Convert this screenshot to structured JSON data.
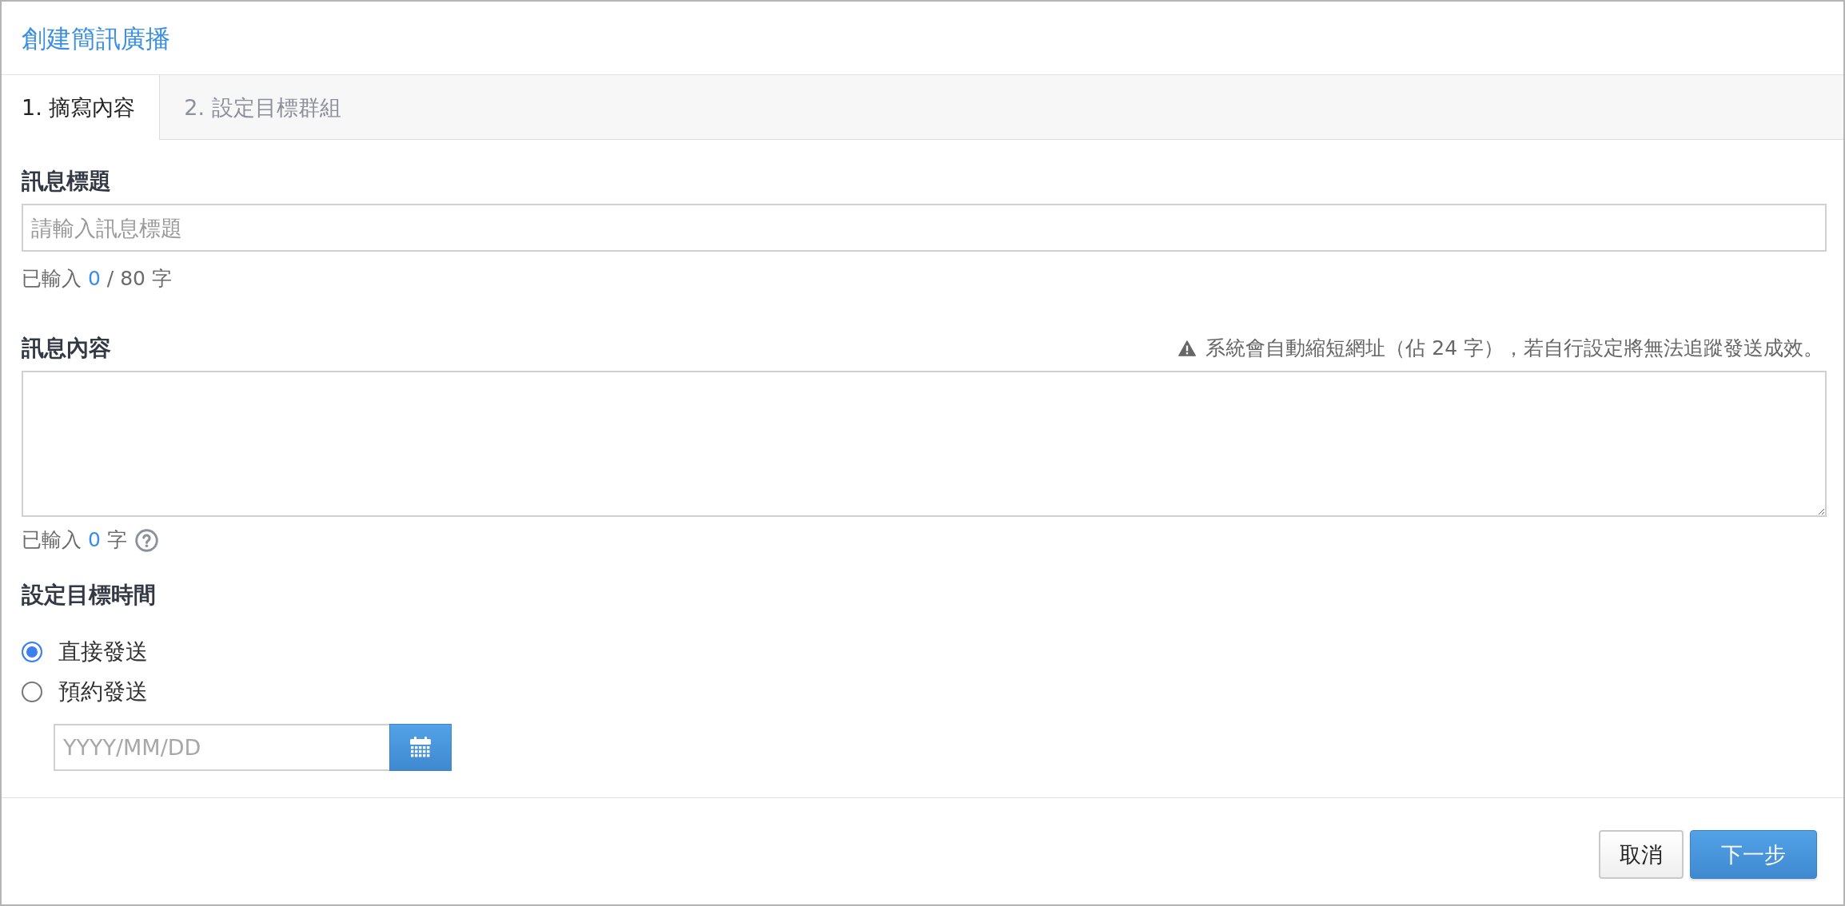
{
  "dialog": {
    "title": "創建簡訊廣播"
  },
  "tabs": [
    {
      "label": "1. 摘寫內容",
      "selected": true
    },
    {
      "label": "2. 設定目標群組",
      "selected": false
    }
  ],
  "title_field": {
    "label": "訊息標題",
    "placeholder": "請輸入訊息標題",
    "counter": {
      "prefix": "已輸入",
      "count": "0",
      "suffix": "/ 80 字"
    }
  },
  "content_field": {
    "label": "訊息內容",
    "warning": "系統會自動縮短網址（佔 24 字），若自行設定將無法追蹤發送成效。",
    "counter": {
      "prefix": "已輸入",
      "count": "0",
      "suffix": "字"
    }
  },
  "schedule": {
    "label": "設定目標時間",
    "options": [
      {
        "label": "直接發送",
        "selected": true
      },
      {
        "label": "預約發送",
        "selected": false
      }
    ],
    "date_field": {
      "placeholder": "YYYY/MM/DD"
    }
  },
  "buttons": [
    {
      "label": "取消",
      "kind": "secondary"
    },
    {
      "label": "下一步",
      "kind": "primary"
    }
  ]
}
